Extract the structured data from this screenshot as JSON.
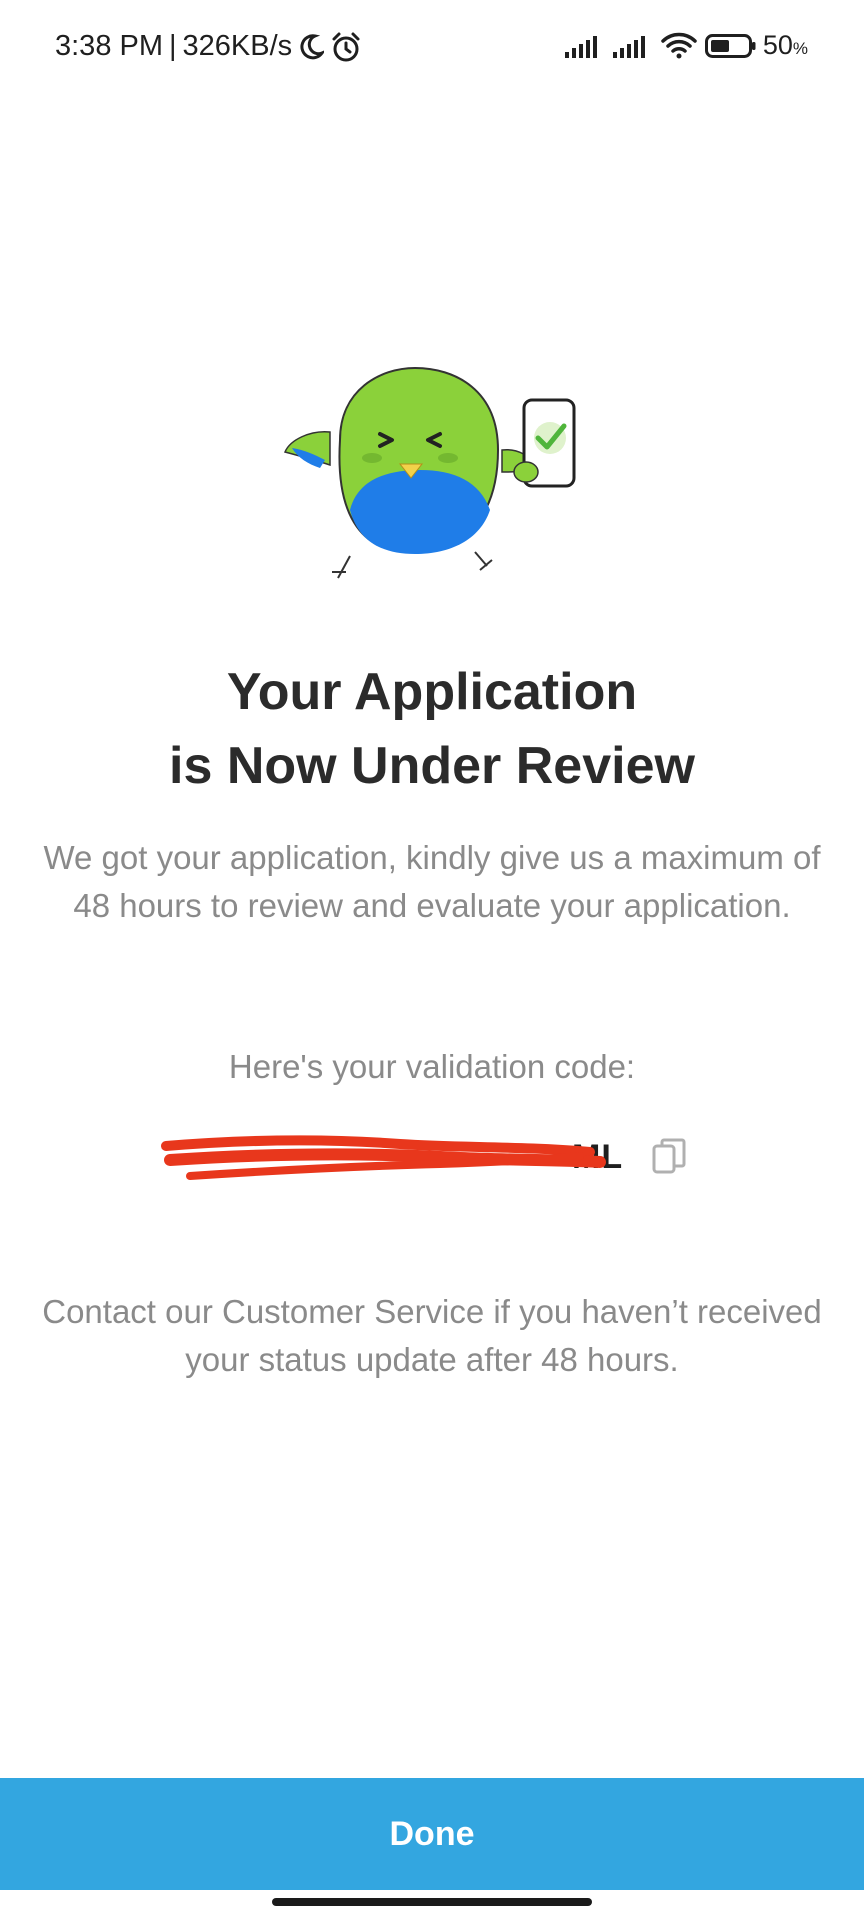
{
  "status_bar": {
    "time": "3:38 PM",
    "separator": "|",
    "network_speed": "326KB/s",
    "icons": [
      "moon-icon",
      "alarm-icon",
      "signal-icon",
      "signal-icon",
      "wifi-icon",
      "battery-icon"
    ],
    "battery_number": "50",
    "battery_unit": "%",
    "battery_level": 0.5
  },
  "illustration": {
    "icon": "bird-mascot-with-phone-check-icon"
  },
  "main": {
    "title_line1": "Your Application",
    "title_line2": "is Now Under Review",
    "description": "We got your application, kindly give us a maximum of 48 hours to review and evaluate your application.",
    "code_label": "Here's your validation code:",
    "code_visible_suffix": "ML",
    "contact_text": "Contact our Customer Service if you haven’t received your status update after 48 hours."
  },
  "footer": {
    "done_label": "Done"
  },
  "colors": {
    "accent": "#33a6e0",
    "redaction": "#e8371c",
    "bird_green": "#8bd13a",
    "bird_blue": "#1f7de8"
  }
}
